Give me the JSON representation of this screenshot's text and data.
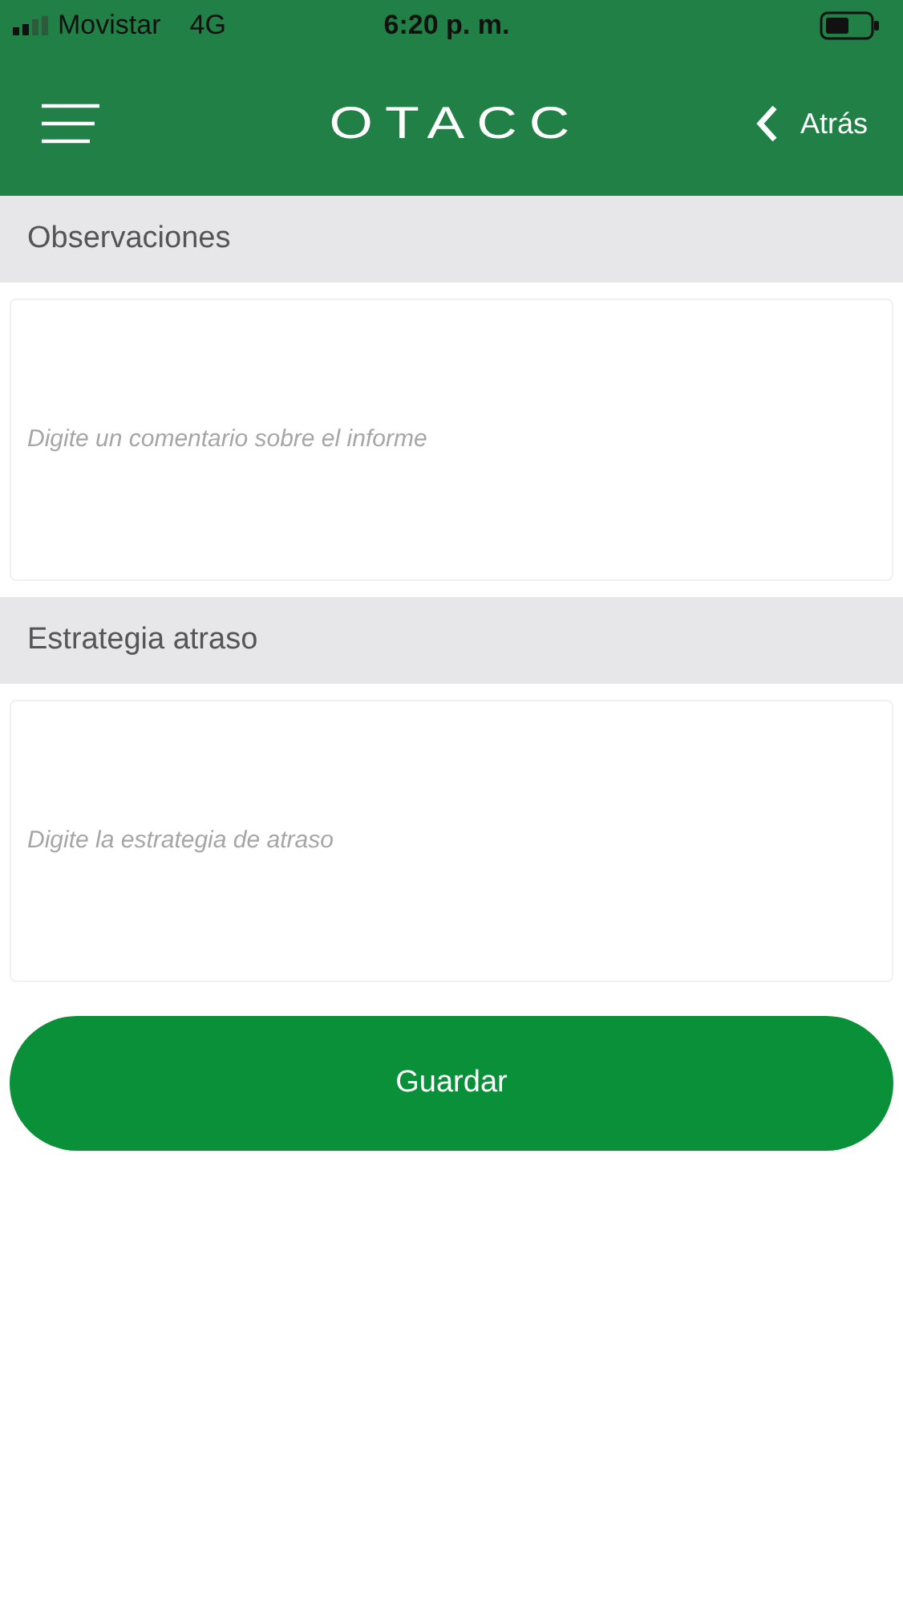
{
  "status_bar": {
    "carrier": "Movistar",
    "network": "4G",
    "time": "6:20 p. m."
  },
  "header": {
    "logo": "OTACC",
    "back": "Atrás"
  },
  "sections": [
    {
      "title": "Observaciones",
      "placeholder": "Digite un comentario sobre el informe"
    },
    {
      "title": "Estrategia atraso",
      "placeholder": "Digite la estrategia de atraso"
    }
  ],
  "save_button": "Guardar"
}
